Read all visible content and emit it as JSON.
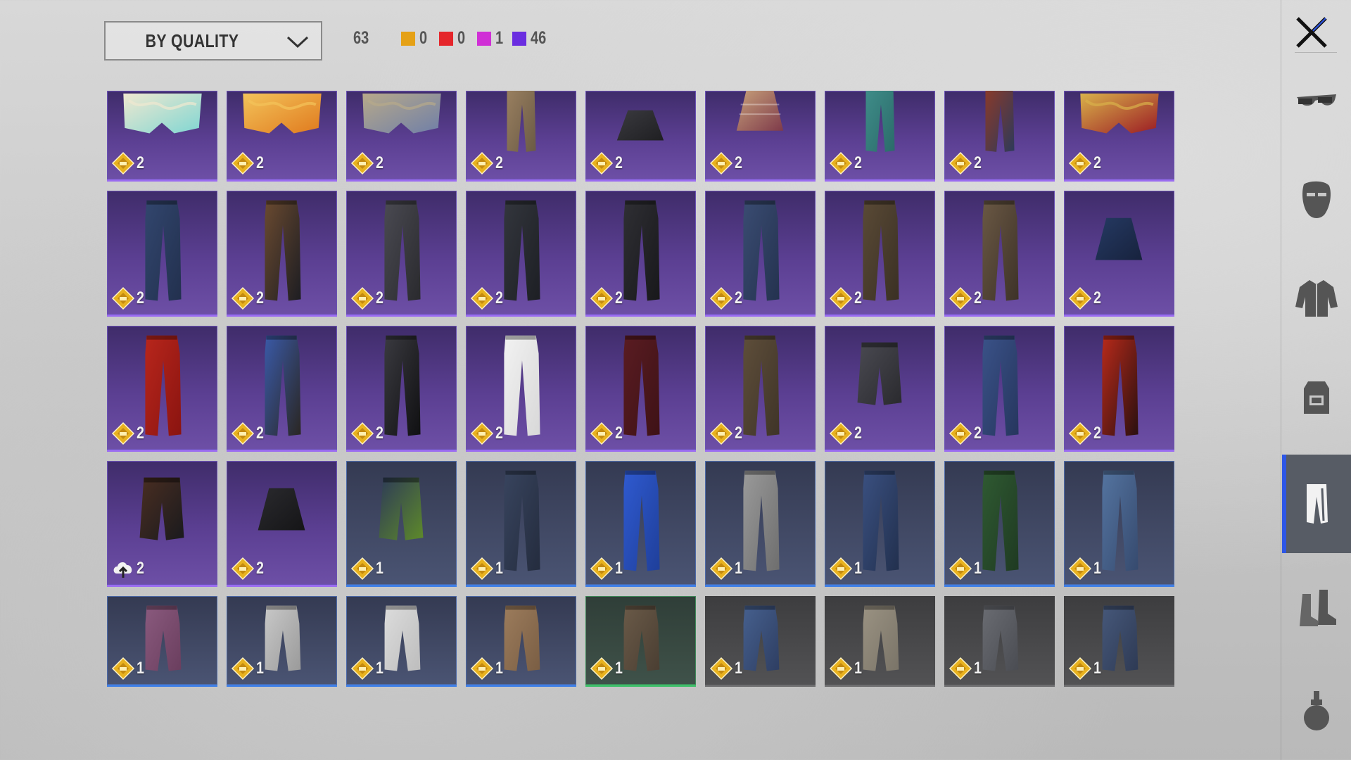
{
  "sort": {
    "label": "BY QUALITY",
    "icon": "chevron-down-icon"
  },
  "summary": {
    "total": "63",
    "tiers": [
      {
        "name": "legendary",
        "color": "#e5a116",
        "count": "0"
      },
      {
        "name": "mythic",
        "color": "#e5262b",
        "count": "0"
      },
      {
        "name": "epic",
        "color": "#d02fd6",
        "count": "1"
      },
      {
        "name": "rare",
        "color": "#6a2de0",
        "count": "46"
      }
    ]
  },
  "close": {
    "icon": "close-icon"
  },
  "categories": [
    {
      "name": "glasses",
      "icon": "glasses-icon",
      "active": false
    },
    {
      "name": "mask",
      "icon": "mask-icon",
      "active": false
    },
    {
      "name": "tops",
      "icon": "jacket-icon",
      "active": false
    },
    {
      "name": "backpack",
      "icon": "backpack-icon",
      "active": false
    },
    {
      "name": "pants",
      "icon": "pants-icon",
      "active": true
    },
    {
      "name": "shoes",
      "icon": "boots-icon",
      "active": false
    },
    {
      "name": "grenade",
      "icon": "grenade-icon",
      "active": false
    }
  ],
  "items": [
    {
      "q": "purple",
      "kind": "briefs",
      "c1": "#7fd6d2",
      "c2": "#f0e8d0",
      "count": "2"
    },
    {
      "q": "purple",
      "kind": "briefs",
      "c1": "#e07a1e",
      "c2": "#f3c35a",
      "count": "2"
    },
    {
      "q": "purple",
      "kind": "briefs",
      "c1": "#6f7fa8",
      "c2": "#b7a98a",
      "count": "2"
    },
    {
      "q": "purple",
      "kind": "pants-crop",
      "c1": "#6a5a45",
      "c2": "#9a8060",
      "count": "2"
    },
    {
      "q": "purple",
      "kind": "skirt",
      "c1": "#1f1f22",
      "c2": "#3a3a3f",
      "count": "2"
    },
    {
      "q": "purple",
      "kind": "skirt-plaid",
      "c1": "#7e3a4a",
      "c2": "#c7a07a",
      "count": "2"
    },
    {
      "q": "purple",
      "kind": "pants-crop",
      "c1": "#2b6b6a",
      "c2": "#3f8d89",
      "count": "2"
    },
    {
      "q": "purple",
      "kind": "pants-crop",
      "c1": "#2d3a5a",
      "c2": "#8a3a2a",
      "count": "2"
    },
    {
      "q": "purple",
      "kind": "boxing-shorts",
      "c1": "#9b1b24",
      "c2": "#d9b14a",
      "count": "2"
    },
    {
      "q": "purple",
      "kind": "pants",
      "c1": "#22304e",
      "c2": "#32466e",
      "count": "2"
    },
    {
      "q": "purple",
      "kind": "pants",
      "c1": "#1d1d22",
      "c2": "#6a4a30",
      "count": "2"
    },
    {
      "q": "purple",
      "kind": "pants",
      "c1": "#2a2a2e",
      "c2": "#4a4a52",
      "count": "2"
    },
    {
      "q": "purple",
      "kind": "pants",
      "c1": "#1d1f24",
      "c2": "#33363d",
      "count": "2"
    },
    {
      "q": "purple",
      "kind": "pants",
      "c1": "#18181b",
      "c2": "#2f2f34",
      "count": "2"
    },
    {
      "q": "purple",
      "kind": "pants",
      "c1": "#24324f",
      "c2": "#3a4c72",
      "count": "2"
    },
    {
      "q": "purple",
      "kind": "pants",
      "c1": "#3a3024",
      "c2": "#5a4a36",
      "count": "2"
    },
    {
      "q": "purple",
      "kind": "pants",
      "c1": "#3d3228",
      "c2": "#6a5844",
      "count": "2"
    },
    {
      "q": "purple",
      "kind": "skirt",
      "c1": "#17223d",
      "c2": "#253a63",
      "count": "2"
    },
    {
      "q": "purple",
      "kind": "pants",
      "c1": "#8a1410",
      "c2": "#b8261c",
      "count": "2"
    },
    {
      "q": "purple",
      "kind": "pants",
      "c1": "#2a2622",
      "c2": "#3a5aa8",
      "count": "2"
    },
    {
      "q": "purple",
      "kind": "pants",
      "c1": "#101012",
      "c2": "#3a3a40",
      "count": "2"
    },
    {
      "q": "purple",
      "kind": "pants",
      "c1": "#d8d8d8",
      "c2": "#f2f2f2",
      "count": "2"
    },
    {
      "q": "purple",
      "kind": "pants",
      "c1": "#3e1216",
      "c2": "#5a1c22",
      "count": "2"
    },
    {
      "q": "purple",
      "kind": "pants",
      "c1": "#3f3428",
      "c2": "#5e4e3a",
      "count": "2"
    },
    {
      "q": "purple",
      "kind": "shorts",
      "c1": "#2a2a2e",
      "c2": "#4a4a52",
      "count": "2"
    },
    {
      "q": "purple",
      "kind": "pants",
      "c1": "#26365e",
      "c2": "#3a5288",
      "count": "2"
    },
    {
      "q": "purple",
      "kind": "pants",
      "c1": "#2a1010",
      "c2": "#b82a1a",
      "count": "2"
    },
    {
      "q": "purple",
      "kind": "shorts",
      "c1": "#1a1a1d",
      "c2": "#4a2e22",
      "count": "2",
      "badge": "cloud-upload-icon"
    },
    {
      "q": "purple",
      "kind": "skirt",
      "c1": "#151517",
      "c2": "#2a2a2e",
      "count": "2"
    },
    {
      "q": "blue",
      "kind": "shorts",
      "c1": "#5e8a2a",
      "c2": "#2d3a58",
      "count": "1"
    },
    {
      "q": "blue",
      "kind": "pants",
      "c1": "#242c3e",
      "c2": "#38445e",
      "count": "1"
    },
    {
      "q": "blue",
      "kind": "pants",
      "c1": "#1f3f9a",
      "c2": "#2f5ad0",
      "count": "1"
    },
    {
      "q": "blue",
      "kind": "pants",
      "c1": "#6e6e6e",
      "c2": "#9a9a9a",
      "count": "1"
    },
    {
      "q": "blue",
      "kind": "pants",
      "c1": "#22304e",
      "c2": "#3a5080",
      "count": "1"
    },
    {
      "q": "blue",
      "kind": "pants",
      "c1": "#1f3a22",
      "c2": "#2f5a32",
      "count": "1"
    },
    {
      "q": "blue",
      "kind": "pants",
      "c1": "#364a6e",
      "c2": "#5474a0",
      "count": "1"
    },
    {
      "q": "blue",
      "kind": "pants",
      "c1": "#6a3e5e",
      "c2": "#8a5a7e",
      "count": "1"
    },
    {
      "q": "blue",
      "kind": "pants",
      "c1": "#9a9a9a",
      "c2": "#c8c8c8",
      "count": "1"
    },
    {
      "q": "blue",
      "kind": "pants",
      "c1": "#bdbdbd",
      "c2": "#dcdcdc",
      "count": "1"
    },
    {
      "q": "blue",
      "kind": "pants",
      "c1": "#7a5e44",
      "c2": "#9c7c5c",
      "count": "1"
    },
    {
      "q": "green",
      "kind": "pants",
      "c1": "#4a3e32",
      "c2": "#6a5a48",
      "count": "1"
    },
    {
      "q": "gray",
      "kind": "pants",
      "c1": "#2e3e62",
      "c2": "#46608e",
      "count": "1"
    },
    {
      "q": "gray",
      "kind": "pants",
      "c1": "#7a7468",
      "c2": "#9a9282",
      "count": "1"
    },
    {
      "q": "gray",
      "kind": "pants",
      "c1": "#4a4c52",
      "c2": "#6a6c72",
      "count": "1"
    },
    {
      "q": "gray",
      "kind": "pants",
      "c1": "#2e3a54",
      "c2": "#46587a",
      "count": "1"
    }
  ]
}
